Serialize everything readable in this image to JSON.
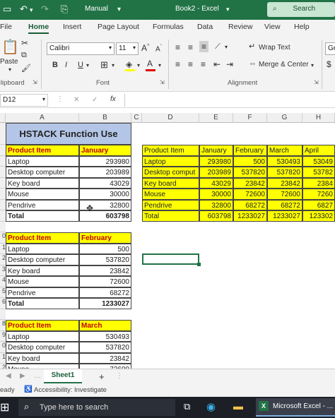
{
  "titlebar": {
    "mode": "Manual",
    "doc_title": "Book2 - Excel",
    "search_label": "Search"
  },
  "ribbon_tabs": [
    "File",
    "Home",
    "Insert",
    "Page Layout",
    "Formulas",
    "Data",
    "Review",
    "View",
    "Help"
  ],
  "ribbon": {
    "paste_label": "Paste",
    "font_name": "Calibri",
    "font_size": "11",
    "bold": "B",
    "italic": "I",
    "underline": "U",
    "wrap_text": "Wrap Text",
    "merge_center": "Merge & Center",
    "general_trunc": "Gene",
    "groups": {
      "clipboard": "Clipboard",
      "font": "Font",
      "alignment": "Alignment"
    }
  },
  "formula_bar": {
    "name_box": "D12",
    "fx": "fx",
    "cancel": "✕",
    "enter": "✓"
  },
  "sheet": {
    "columns": [
      "A",
      "B",
      "C",
      "D",
      "E",
      "F",
      "G",
      "H"
    ],
    "row_numbers": [
      "",
      "",
      "",
      "",
      "",
      "",
      "",
      "",
      "0",
      "1",
      "2",
      "3",
      "4",
      "5",
      "6",
      "",
      "8",
      "9",
      "0",
      "1",
      "2"
    ],
    "title": "HSTACK Function Use",
    "block_jan": {
      "header": [
        "Product Item",
        "January"
      ],
      "rows": [
        [
          "Laptop",
          "293980"
        ],
        [
          "Desktop computer",
          "203989"
        ],
        [
          "Key board",
          "43029"
        ],
        [
          "Mouse",
          "30000"
        ],
        [
          "Pendrive",
          "32800"
        ]
      ],
      "total": [
        "Total",
        "603798"
      ]
    },
    "block_feb": {
      "header": [
        "Product Item",
        "February"
      ],
      "rows": [
        [
          "Laptop",
          "500"
        ],
        [
          "Desktop computer",
          "537820"
        ],
        [
          "Key board",
          "23842"
        ],
        [
          "Mouse",
          "72600"
        ],
        [
          "Pendrive",
          "68272"
        ]
      ],
      "total": [
        "Total",
        "1233027"
      ]
    },
    "block_mar": {
      "header": [
        "Product Item",
        "March"
      ],
      "rows": [
        [
          "Laptop",
          "530493"
        ],
        [
          "Desktop computer",
          "537820"
        ],
        [
          "Key board",
          "23842"
        ],
        [
          "Mouse",
          "72600"
        ]
      ]
    },
    "hstack": {
      "header": [
        "Product Item",
        "January",
        "February",
        "March",
        "April"
      ],
      "rows": [
        [
          "Laptop",
          "293980",
          "500",
          "530493",
          "53049"
        ],
        [
          "Desktop comput",
          "203989",
          "537820",
          "537820",
          "53782"
        ],
        [
          "Key board",
          "43029",
          "23842",
          "23842",
          "2384"
        ],
        [
          "Mouse",
          "30000",
          "72600",
          "72600",
          "7260"
        ],
        [
          "Pendrive",
          "32800",
          "68272",
          "68272",
          "6827"
        ],
        [
          "Total",
          "603798",
          "1233027",
          "1233027",
          "123302"
        ]
      ]
    }
  },
  "sheet_tabs": {
    "active": "Sheet1",
    "add": "+"
  },
  "status": {
    "ready": "eady",
    "accessibility": "Accessibility: Investigate"
  },
  "taskbar": {
    "search_placeholder": "Type here to search",
    "excel_app": "Microsoft Excel - ..."
  },
  "colors": {
    "excel_green": "#217346",
    "highlight_yellow": "#ffff00",
    "header_blue": "#b4c6e7",
    "header_red": "#c00000"
  }
}
